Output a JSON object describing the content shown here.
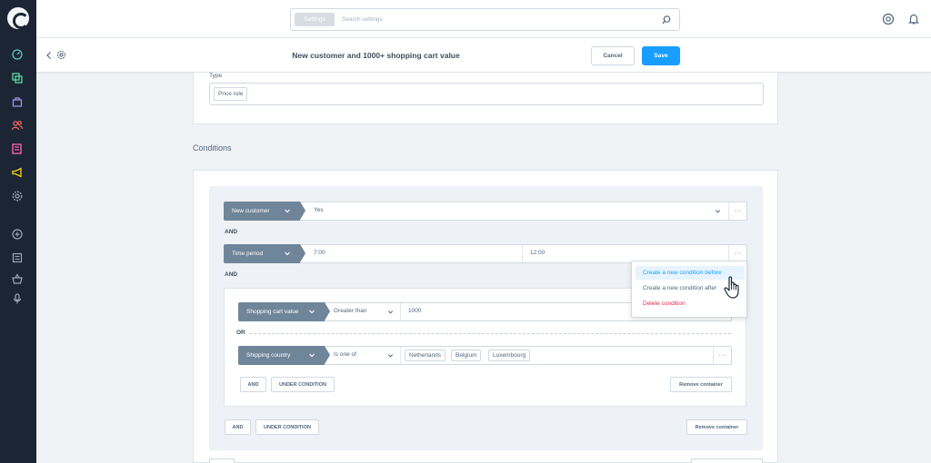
{
  "colors": {
    "sidebar_bg": "#1b2533",
    "accent": "#189eff",
    "field_chip": "#6f8599",
    "danger": "#de294c"
  },
  "sidebar": {
    "items": [
      {
        "icon": "dashboard-icon",
        "color": "#5fc9c1"
      },
      {
        "icon": "catalog-icon",
        "color": "#57d9a3"
      },
      {
        "icon": "orders-icon",
        "color": "#a092f0"
      },
      {
        "icon": "customers-icon",
        "color": "#ff6a6a"
      },
      {
        "icon": "content-icon",
        "color": "#ff68b4"
      },
      {
        "icon": "marketing-icon",
        "color": "#ffd700"
      },
      {
        "icon": "settings-icon",
        "color": "#9aa8b5"
      },
      {
        "icon": "add-icon",
        "color": "#9aa8b5"
      },
      {
        "icon": "list-icon",
        "color": "#9aa8b5"
      },
      {
        "icon": "basket-icon",
        "color": "#9aa8b5"
      },
      {
        "icon": "microphone-icon",
        "color": "#9aa8b5"
      }
    ]
  },
  "header": {
    "search_chip": "Settings",
    "search_placeholder": "Search settings"
  },
  "toolbar": {
    "title": "New customer and 1000+ shopping cart value",
    "cancel_label": "Cancel",
    "save_label": "Save"
  },
  "type_section": {
    "label": "Type",
    "value": "Price rule"
  },
  "conditions": {
    "title": "Conditions",
    "rows": {
      "new_customer": {
        "field": "New customer",
        "value": "Yes"
      },
      "time_period": {
        "field": "Time period",
        "from": "7:00",
        "to": "12:00"
      }
    },
    "and_1": "AND",
    "and_2": "AND",
    "inner": {
      "cart": {
        "field": "Shopping cart value",
        "operator": "Greater than",
        "value": "1000"
      },
      "or_label": "OR",
      "country": {
        "field": "Shipping country",
        "operator": "Is one of",
        "tags": [
          "Netherlands",
          "Belgium",
          "Luxembourg"
        ]
      },
      "and_button": "AND",
      "subcondition_button": "UNDER CONDITION",
      "remove_button": "Remove container"
    },
    "outer_and_button": "AND",
    "outer_subcondition_button": "UNDER CONDITION",
    "outer_remove_button": "Remove container",
    "more_label": "···"
  },
  "context_menu": {
    "items": [
      "Create a new condition before",
      "Create a new condition after",
      "Delete condition"
    ]
  }
}
